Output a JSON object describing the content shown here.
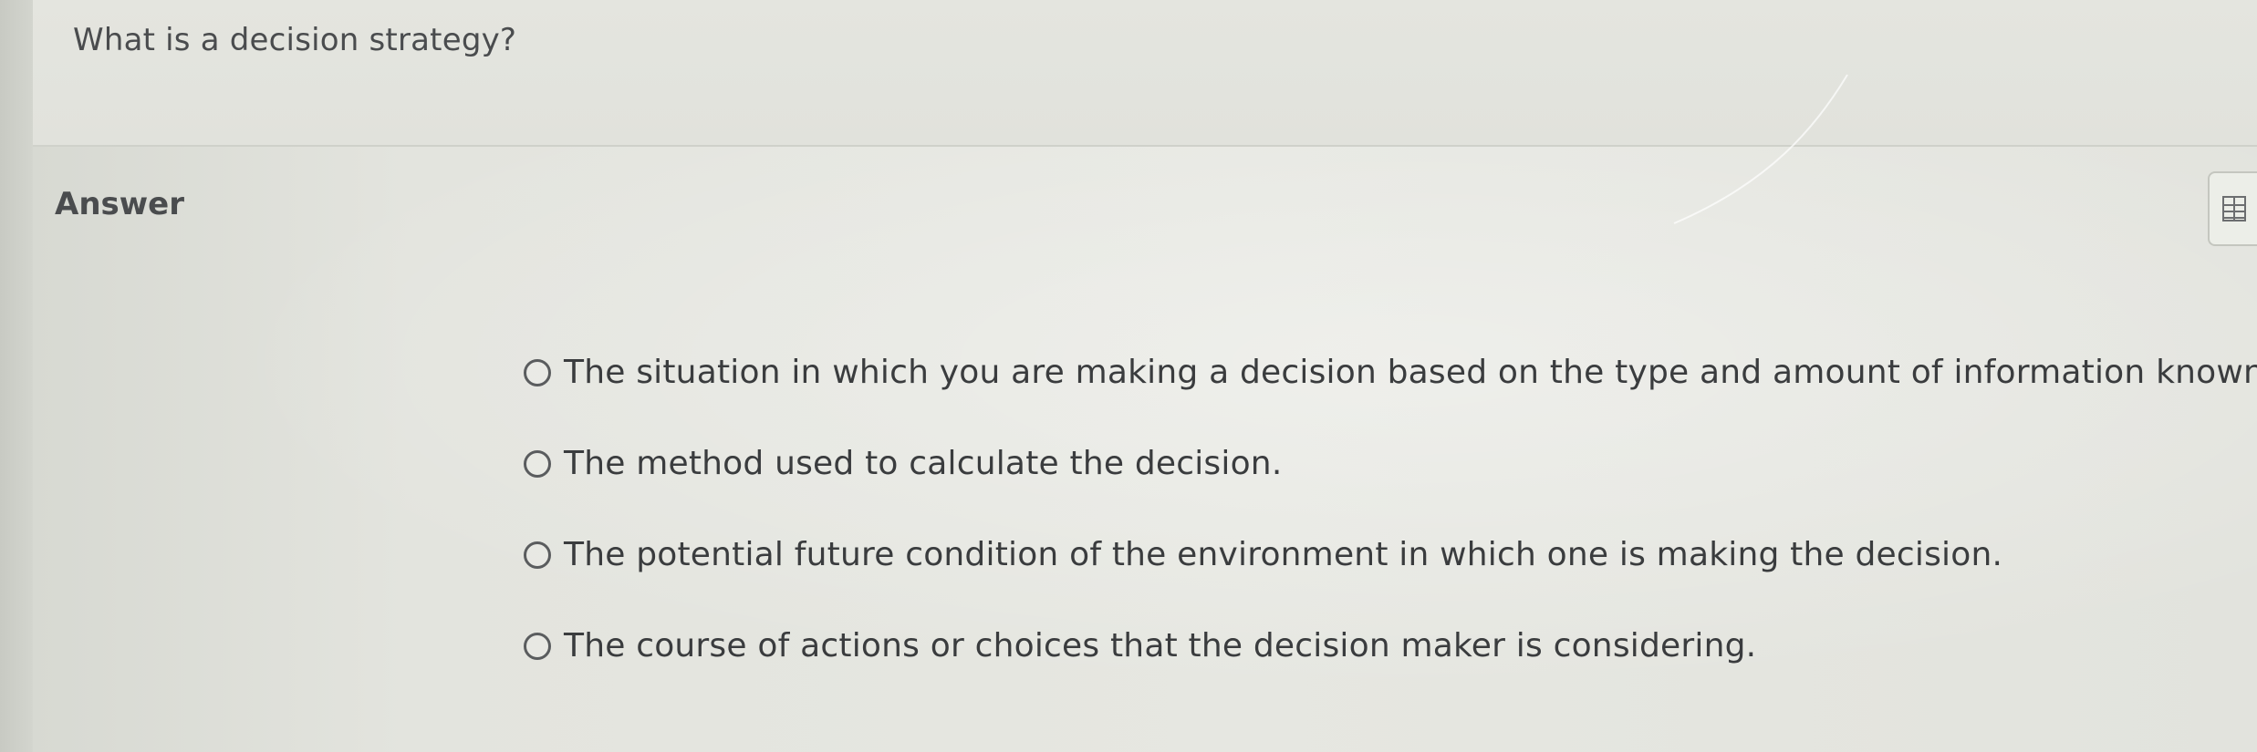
{
  "question": {
    "text": "What is a decision strategy?"
  },
  "answer": {
    "label": "Answer",
    "options": [
      {
        "label": "The situation in which you are making a decision based on the type and amount of information known."
      },
      {
        "label": "The method used to calculate the decision."
      },
      {
        "label": "The potential future condition of the environment in which one is making the decision."
      },
      {
        "label": "The course of actions or choices that the decision maker is considering."
      }
    ]
  },
  "side_tool": {
    "icon": "table-icon"
  },
  "colors": {
    "background": "#e3e4de",
    "text": "#3a3c3e",
    "divider": "#cfd1ca"
  }
}
